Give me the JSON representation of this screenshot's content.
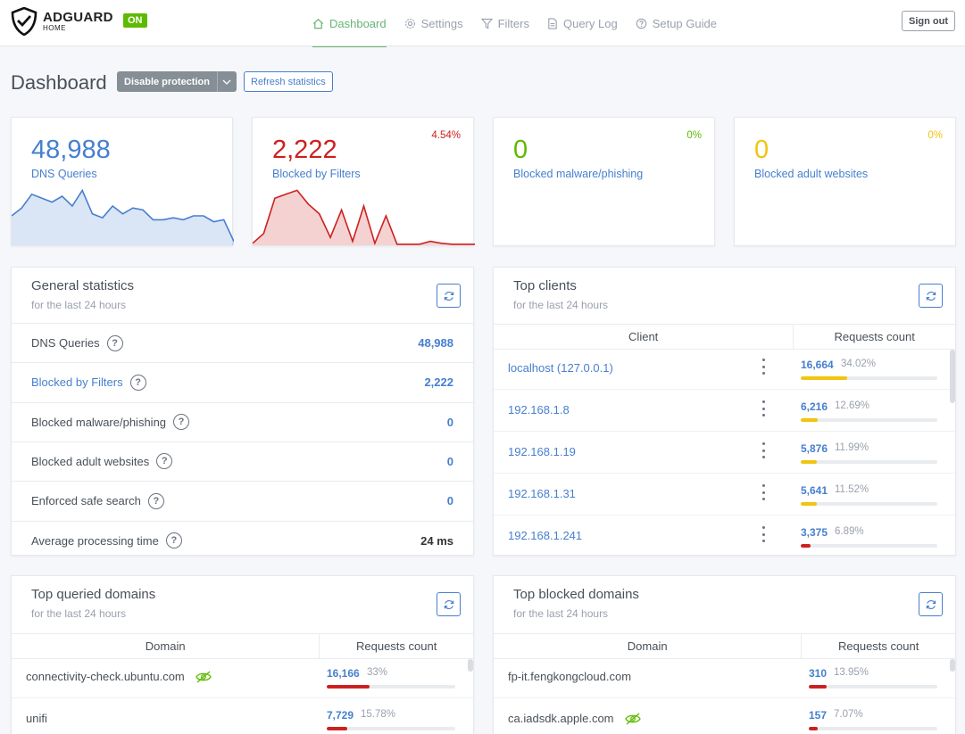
{
  "header": {
    "brand": "ADGUARD",
    "brand_sub": "HOME",
    "status_badge": "ON",
    "nav": [
      {
        "label": "Dashboard",
        "icon": "home-icon",
        "active": true
      },
      {
        "label": "Settings",
        "icon": "gear-icon"
      },
      {
        "label": "Filters",
        "icon": "filter-icon"
      },
      {
        "label": "Query Log",
        "icon": "document-icon"
      },
      {
        "label": "Setup Guide",
        "icon": "help-circle-icon"
      }
    ],
    "sign_out": "Sign out"
  },
  "page": {
    "title": "Dashboard",
    "disable_protection": "Disable protection",
    "refresh_statistics": "Refresh statistics"
  },
  "stat_cards": [
    {
      "value": "48,988",
      "label": "DNS Queries",
      "percent": "",
      "color": "#467fcf",
      "sparkline": [
        30,
        38,
        52,
        48,
        44,
        50,
        40,
        56,
        32,
        28,
        40,
        32,
        38,
        36,
        26,
        26,
        28,
        26,
        30,
        30,
        24,
        26,
        4
      ]
    },
    {
      "value": "2,222",
      "label": "Blocked by Filters",
      "percent": "4.54%",
      "color": "#cd201f",
      "sparkline": [
        2,
        12,
        48,
        52,
        56,
        42,
        32,
        8,
        36,
        4,
        40,
        2,
        30,
        1,
        1,
        1,
        4,
        2,
        1,
        1,
        1
      ]
    },
    {
      "value": "0",
      "label": "Blocked malware/phishing",
      "percent": "0%",
      "color": "#5eba00"
    },
    {
      "value": "0",
      "label": "Blocked adult websites",
      "percent": "0%",
      "color": "#f1c40f"
    }
  ],
  "general_stats": {
    "title": "General statistics",
    "subtitle": "for the last 24 hours",
    "rows": [
      {
        "label": "DNS Queries",
        "value": "48,988",
        "label_link": false,
        "dark": false
      },
      {
        "label": "Blocked by Filters",
        "value": "2,222",
        "label_link": true,
        "dark": false
      },
      {
        "label": "Blocked malware/phishing",
        "value": "0",
        "label_link": false,
        "dark": false
      },
      {
        "label": "Blocked adult websites",
        "value": "0",
        "label_link": false,
        "dark": false
      },
      {
        "label": "Enforced safe search",
        "value": "0",
        "label_link": false,
        "dark": false
      },
      {
        "label": "Average processing time",
        "value": "24 ms",
        "label_link": false,
        "dark": true
      }
    ]
  },
  "top_clients": {
    "title": "Top clients",
    "subtitle": "for the last 24 hours",
    "columns": [
      "Client",
      "Requests count"
    ],
    "rows": [
      {
        "name": "localhost (127.0.0.1)",
        "count": "16,664",
        "percent": "34.02%",
        "fill": 34.02,
        "color": "#f1c40f"
      },
      {
        "name": "192.168.1.8",
        "count": "6,216",
        "percent": "12.69%",
        "fill": 12.69,
        "color": "#f1c40f"
      },
      {
        "name": "192.168.1.19",
        "count": "5,876",
        "percent": "11.99%",
        "fill": 11.99,
        "color": "#f1c40f"
      },
      {
        "name": "192.168.1.31",
        "count": "5,641",
        "percent": "11.52%",
        "fill": 11.52,
        "color": "#f1c40f"
      },
      {
        "name": "192.168.1.241",
        "count": "3,375",
        "percent": "6.89%",
        "fill": 6.89,
        "color": "#cd201f"
      }
    ]
  },
  "top_queried": {
    "title": "Top queried domains",
    "subtitle": "for the last 24 hours",
    "columns": [
      "Domain",
      "Requests count"
    ],
    "rows": [
      {
        "name": "connectivity-check.ubuntu.com",
        "count": "16,166",
        "percent": "33%",
        "fill": 33,
        "color": "#cd201f",
        "eye": true
      },
      {
        "name": "unifi",
        "count": "7,729",
        "percent": "15.78%",
        "fill": 15.78,
        "color": "#cd201f",
        "eye": false
      }
    ]
  },
  "top_blocked": {
    "title": "Top blocked domains",
    "subtitle": "for the last 24 hours",
    "columns": [
      "Domain",
      "Requests count"
    ],
    "rows": [
      {
        "name": "fp-it.fengkongcloud.com",
        "count": "310",
        "percent": "13.95%",
        "fill": 13.95,
        "color": "#cd201f",
        "eye": false
      },
      {
        "name": "ca.iadsdk.apple.com",
        "count": "157",
        "percent": "7.07%",
        "fill": 7.07,
        "color": "#cd201f",
        "eye": true
      }
    ]
  }
}
